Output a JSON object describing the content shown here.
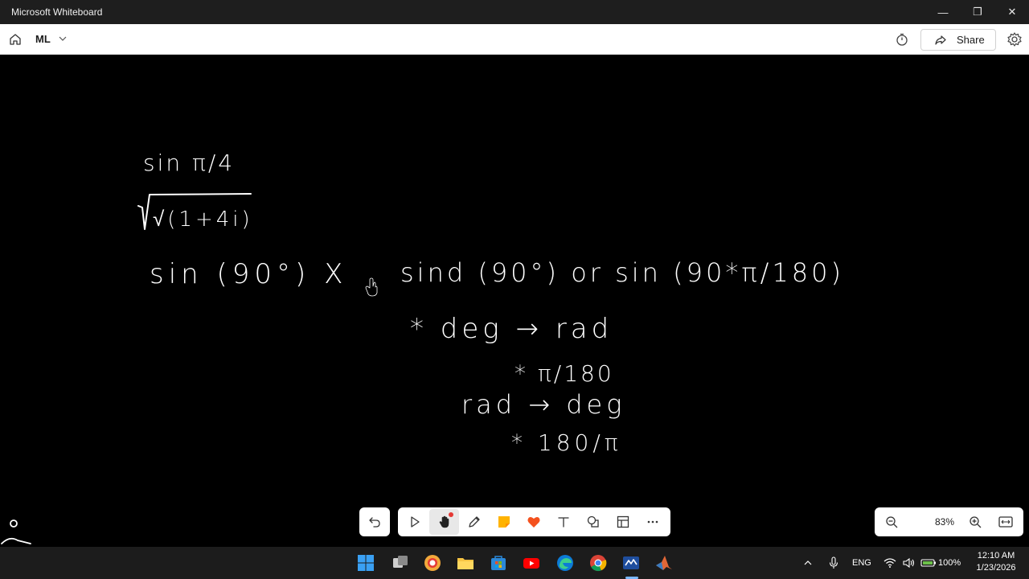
{
  "window": {
    "title": "Microsoft Whiteboard",
    "minimize_glyph": "—",
    "restore_glyph": "❐",
    "close_glyph": "✕"
  },
  "header": {
    "board_name": "ML",
    "share_label": "Share"
  },
  "canvas": {
    "ink_lines": [
      "sin π/4",
      "√(1+4i)",
      "sin (90°) X",
      "sind (90°) or sin (90*π/180)",
      "* deg → rad",
      "* π/180",
      "rad → deg",
      "* 180/π"
    ]
  },
  "toolbar": {
    "tools": [
      "undo-icon",
      "select-icon",
      "pan-hand-icon",
      "pen-icon",
      "sticky-note-icon",
      "reactions-heart-icon",
      "text-icon",
      "shapes-icon",
      "templates-icon",
      "more-icon"
    ]
  },
  "zoom": {
    "level": "83%"
  },
  "taskbar": {
    "apps": [
      "windows-start-icon",
      "task-view-icon",
      "chrome-canary-icon",
      "file-explorer-icon",
      "ms-store-icon",
      "youtube-icon",
      "edge-icon",
      "chrome-icon",
      "whiteboard-icon",
      "matlab-icon"
    ],
    "language": "ENG",
    "battery": "100%",
    "time": "12:10 AM",
    "date": "1/23/2026"
  },
  "colors": {
    "canvas_bg": "#000000",
    "ink": "#ffffff",
    "accent": "#0078d4"
  }
}
